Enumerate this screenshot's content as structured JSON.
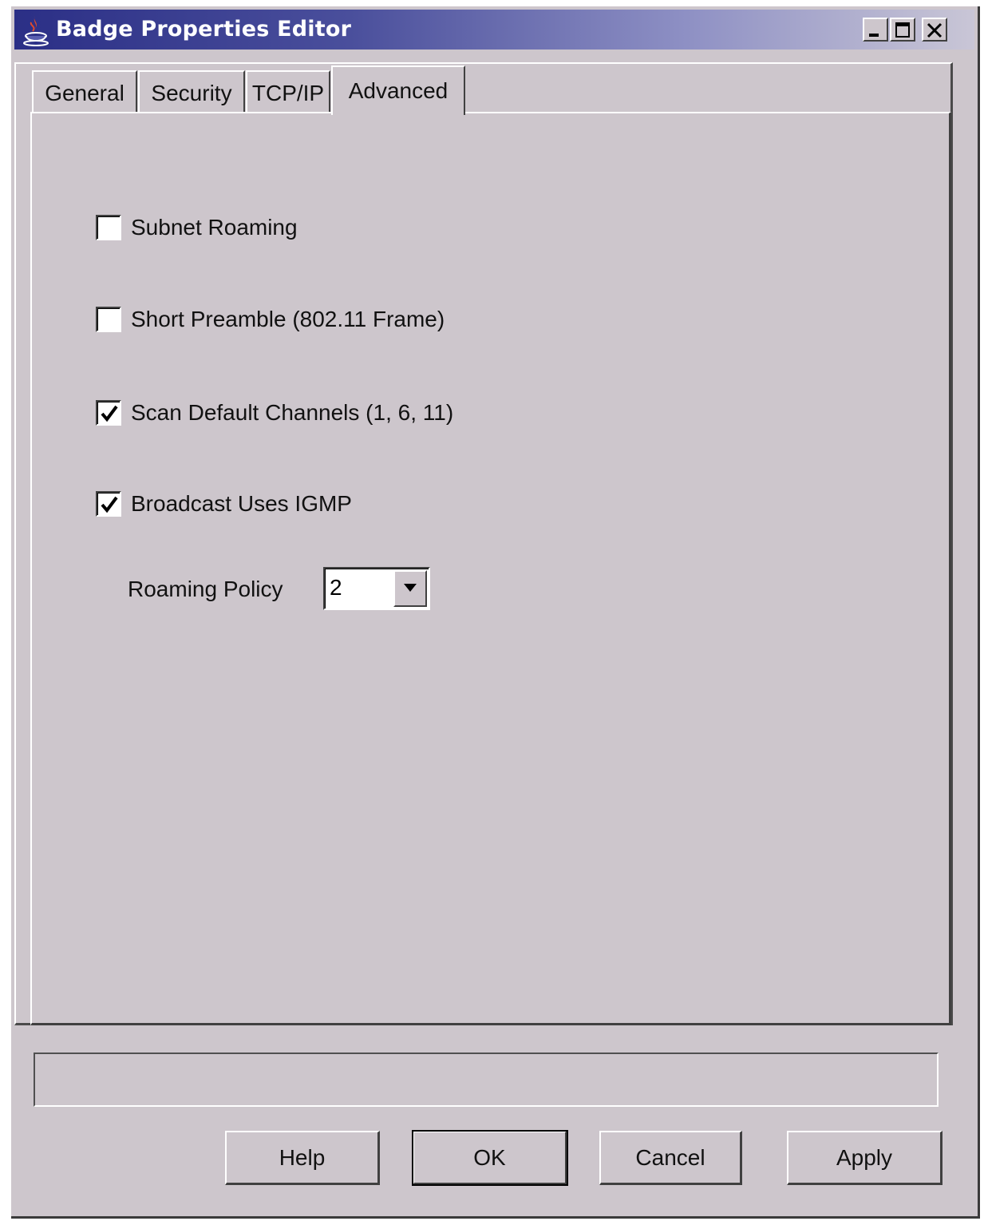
{
  "window": {
    "title": "Badge Properties Editor"
  },
  "tabs": [
    {
      "label": "General",
      "active": false
    },
    {
      "label": "Security",
      "active": false
    },
    {
      "label": "TCP/IP",
      "active": false
    },
    {
      "label": "Advanced",
      "active": true
    }
  ],
  "advanced": {
    "options": [
      {
        "label": "Subnet Roaming",
        "checked": false
      },
      {
        "label": "Short Preamble (802.11 Frame)",
        "checked": false
      },
      {
        "label": "Scan Default Channels (1, 6, 11)",
        "checked": true
      },
      {
        "label": "Broadcast Uses IGMP",
        "checked": true
      }
    ],
    "roaming_policy": {
      "label": "Roaming Policy",
      "value": "2"
    }
  },
  "status": {
    "text": ""
  },
  "buttons": {
    "help": "Help",
    "ok": "OK",
    "cancel": "Cancel",
    "apply": "Apply"
  }
}
